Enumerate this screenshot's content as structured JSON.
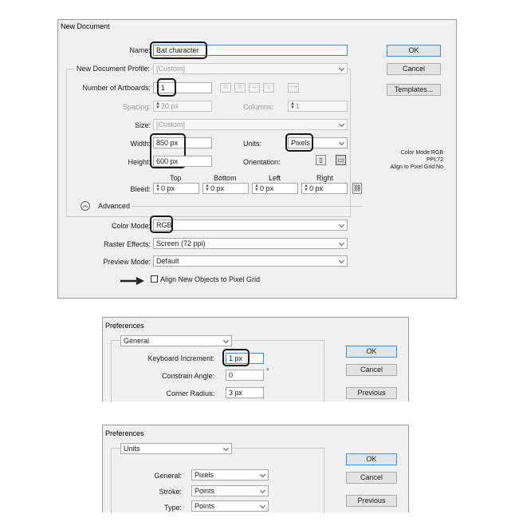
{
  "new_document": {
    "title": "New Document",
    "name_label": "Name:",
    "name_value": "Bat character",
    "profile_label": "New Document Profile:",
    "profile_value": "[Custom]",
    "artboards_label": "Number of Artboards:",
    "artboards_value": "1",
    "spacing_label": "Spacing:",
    "spacing_value": "20 px",
    "columns_label": "Columns:",
    "columns_value": "1",
    "size_label": "Size:",
    "size_value": "[Custom]",
    "width_label": "Width:",
    "width_value": "850 px",
    "units_label": "Units:",
    "units_value": "Pixels",
    "height_label": "Height:",
    "height_value": "600 px",
    "orientation_label": "Orientation:",
    "bleed_label": "Bleed:",
    "bleed_headers": [
      "Top",
      "Bottom",
      "Left",
      "Right"
    ],
    "bleed_values": [
      "0 px",
      "0 px",
      "0 px",
      "0 px"
    ],
    "advanced_label": "Advanced",
    "color_mode_label": "Color Mode:",
    "color_mode_value": "RGB",
    "raster_label": "Raster Effects:",
    "raster_value": "Screen (72 ppi)",
    "preview_label": "Preview Mode:",
    "preview_value": "Default",
    "align_label": "Align New Objects to Pixel Grid",
    "align_checked": false,
    "ok": "OK",
    "cancel": "Cancel",
    "templates": "Templates...",
    "info_lines": [
      "Color Mode:RGB",
      "PPI:72",
      "Align to Pixel Grid:No"
    ]
  },
  "prefs_general": {
    "title": "Preferences",
    "section": "General",
    "keyboard_label": "Keyboard Increment:",
    "keyboard_value": "1 px",
    "constrain_label": "Constrain Angle:",
    "constrain_value": "0",
    "degree": "°",
    "corner_label": "Corner Radius:",
    "corner_value": "3 px",
    "ok": "OK",
    "cancel": "Cancel",
    "previous": "Previous"
  },
  "prefs_units": {
    "title": "Preferences",
    "section": "Units",
    "general_label": "General:",
    "general_value": "Pixels",
    "stroke_label": "Stroke:",
    "stroke_value": "Points",
    "type_label": "Type:",
    "type_value": "Points",
    "ok": "OK",
    "cancel": "Cancel",
    "previous": "Previous"
  },
  "colors": {
    "accent": "#3c8fd6",
    "highlight": "#1a1a1a",
    "dialog_bg": "#f0f0f0"
  }
}
